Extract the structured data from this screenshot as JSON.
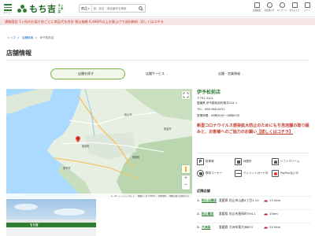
{
  "header": {
    "menu_label": "メニュー",
    "logo_text": "もち吉",
    "logo_sub": "ネット本店",
    "search_category": "商品",
    "search_placeholder": "例：品名・商品番号を検索",
    "nav": [
      "店舗検索",
      "お客様の声",
      "マイページ",
      "お気に入り",
      "カート"
    ]
  },
  "notice": {
    "text": "通販限定 1ヶ所のお届け先ごとに商品代金合計 税込価格 6,480円以上お買上げで送料無料",
    "link": "詳しくはコチラ"
  },
  "breadcrumb": [
    "トップ",
    "店舗検索",
    "伊予松前店"
  ],
  "page_title": "店舗情報",
  "tabs": [
    "店舗を探す",
    "店舗サービス",
    "店舗・営業情報"
  ],
  "map": {
    "labels": [
      "松山市",
      "伊予市",
      "松前町",
      "東温市",
      "砥部町"
    ],
    "footer": [
      "キーボードショートカット",
      "地図データ ©2022",
      "利用規約",
      "地図の誤りを報告する"
    ],
    "google": "Google"
  },
  "photo": {
    "sign": "もち吉"
  },
  "store": {
    "name": "伊予松前店",
    "postal": "〒791-3101",
    "address": "愛媛県 伊予郡松前町筒井414-1",
    "tel": "TEL：089-960-6251",
    "hours": "営業時間：09時30分～18時00分",
    "covid_text": "新型コロナウイルス感染拡大防止のためにもち吉店舗の取り組みと、お客様へのご協力のお願い",
    "covid_link": "【詳しくはコチラ】"
  },
  "services": [
    "駐車場",
    "休憩所",
    "ソフトクリーム",
    "喫茶コーナー",
    "クレジットカード可",
    "PayPay払い可"
  ],
  "nearby": {
    "title": "近隣店舗",
    "stores": [
      {
        "num": "1.",
        "name": "松山山越店",
        "pref": "愛媛県",
        "addr": "松山市山越4丁目1-10",
        "dist": "13.4km"
      },
      {
        "num": "2.",
        "name": "松山南店",
        "pref": "愛媛県",
        "addr": "松山市星岡町594-1",
        "dist": "15km"
      },
      {
        "num": "3.",
        "name": "大洲店",
        "pref": "愛媛県",
        "addr": "大洲市東大洲823",
        "dist": "25.9km"
      }
    ]
  },
  "colors": {
    "brand_green": "#2e7d32",
    "notice_red": "#c0392b",
    "notice_bg": "#f7e5e5",
    "map_water": "#aadaff"
  }
}
